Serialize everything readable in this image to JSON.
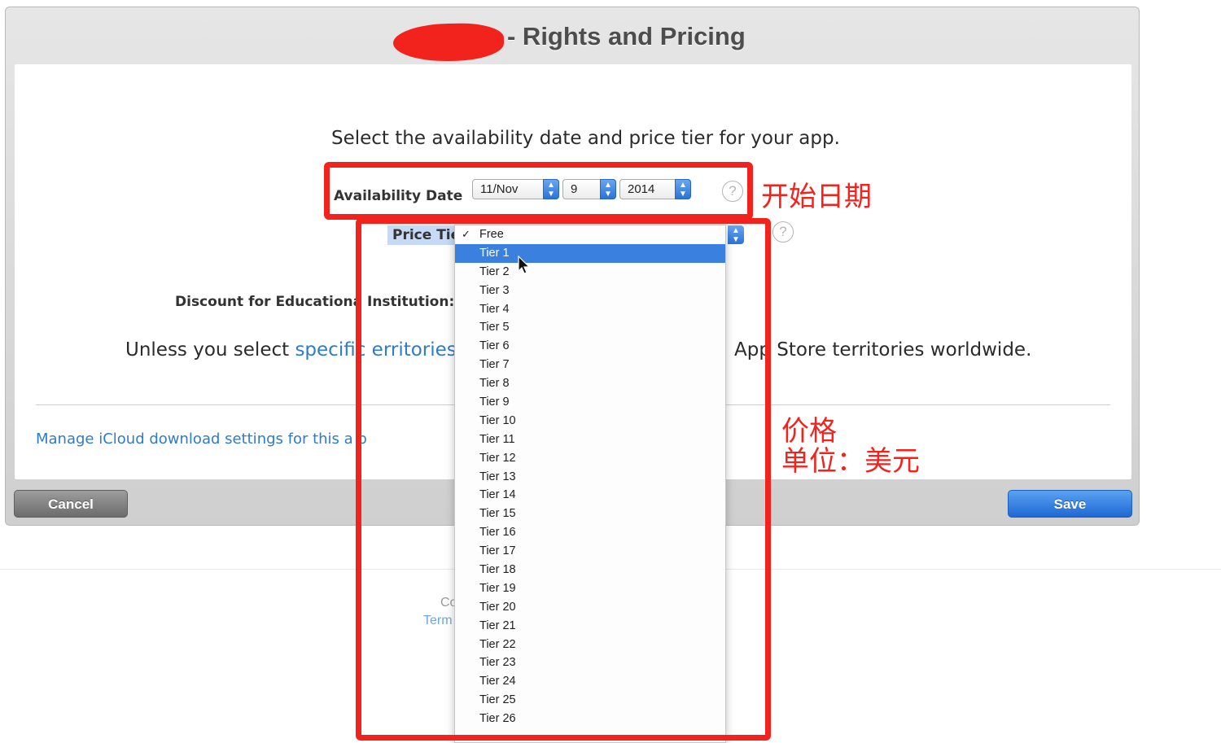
{
  "dialog": {
    "title": "- Rights and Pricing",
    "instruction": "Select the availability date and price tier for your app."
  },
  "availability": {
    "label": "Availability Date",
    "month": "11/Nov",
    "day": "9",
    "year": "2014",
    "help_glyph": "?"
  },
  "price_tier": {
    "label": "Price Tie",
    "options": [
      "Free",
      "Tier 1",
      "Tier 2",
      "Tier 3",
      "Tier 4",
      "Tier 5",
      "Tier 6",
      "Tier 7",
      "Tier 8",
      "Tier 9",
      "Tier 10",
      "Tier 11",
      "Tier 12",
      "Tier 13",
      "Tier 14",
      "Tier 15",
      "Tier 16",
      "Tier 17",
      "Tier 18",
      "Tier 19",
      "Tier 20",
      "Tier 21",
      "Tier 22",
      "Tier 23",
      "Tier 24",
      "Tier 25",
      "Tier 26"
    ],
    "checked_option": "Free",
    "highlighted_option": "Tier 1",
    "help_glyph": "?"
  },
  "discount": {
    "label": "Discount for Educationa  Institution:"
  },
  "territories": {
    "prefix": "Unless you select ",
    "link": "specific",
    "link2": "erritories",
    "suffix": ",",
    "tail": "App Store territories worldwide."
  },
  "icloud": {
    "link": "Manage iCloud download settings for this a  p"
  },
  "buttons": {
    "cancel": "Cancel",
    "save": "Save"
  },
  "footer": {
    "line1": "Co",
    "line2": "Term"
  },
  "annotations": {
    "date_note": "开始日期",
    "price_note_line1": "价格",
    "price_note_line2": "单位：美元",
    "color": "#f2231c"
  },
  "icons": {
    "select_arrows": "updown-chevron-icon",
    "checkmark": "checkmark-icon",
    "cursor": "mouse-pointer-icon",
    "help": "question-mark-icon"
  }
}
